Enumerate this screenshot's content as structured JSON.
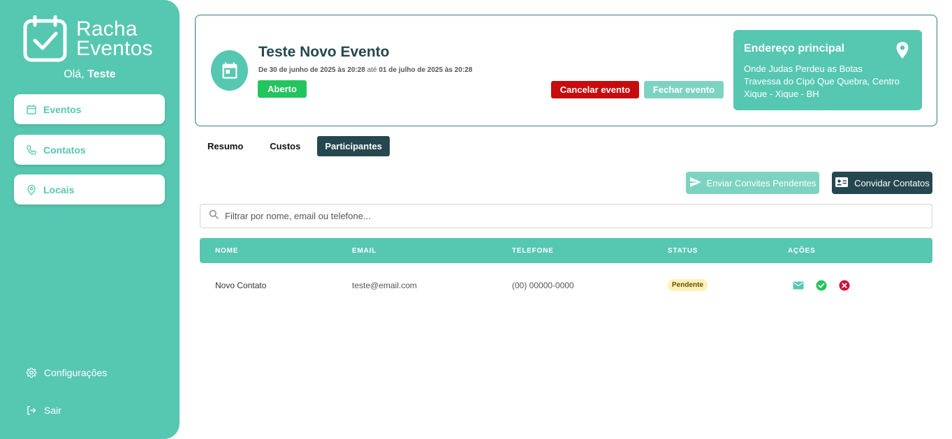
{
  "brand": {
    "line1": "Racha",
    "line2": "Eventos"
  },
  "greeting": {
    "prefix": "Olá,",
    "name": "Teste"
  },
  "sidebar": {
    "items": [
      {
        "label": "Eventos",
        "icon": "calendar-icon"
      },
      {
        "label": "Contatos",
        "icon": "phone-icon"
      },
      {
        "label": "Locais",
        "icon": "location-pin-icon"
      }
    ],
    "settings_label": "Configurações",
    "logout_label": "Sair"
  },
  "event": {
    "title": "Teste Novo Evento",
    "dates": {
      "prefix": "De",
      "start": "30 de junho de 2025 às 20:28",
      "mid": "até",
      "end": "01 de julho de 2025 às 20:28"
    },
    "status": "Aberto",
    "cancel_label": "Cancelar evento",
    "close_label": "Fechar evento"
  },
  "address": {
    "title": "Endereço principal",
    "lines": [
      "Onde Judas Perdeu as Botas",
      "Travessa do Cipó Que Quebra, Centro",
      "Xique - Xique - BH"
    ]
  },
  "tabs": [
    {
      "label": "Resumo",
      "active": false
    },
    {
      "label": "Custos",
      "active": false
    },
    {
      "label": "Participantes",
      "active": true
    }
  ],
  "actions": {
    "send_pending_label": "Enviar Convites Pendentes",
    "invite_contacts_label": "Convidar Contatos"
  },
  "search": {
    "placeholder": "Filtrar por nome, email ou telefone...",
    "value": ""
  },
  "table": {
    "headers": [
      "NOME",
      "EMAIL",
      "TELEFONE",
      "STATUS",
      "AÇÕES"
    ],
    "rows": [
      {
        "name": "Novo Contato",
        "email": "teste@email.com",
        "phone": "(00) 00000-0000",
        "status": "Pendente"
      }
    ]
  },
  "colors": {
    "primary": "#56c7b1",
    "dark": "#25474f",
    "success": "#22c55e",
    "danger": "#c80b0b"
  }
}
